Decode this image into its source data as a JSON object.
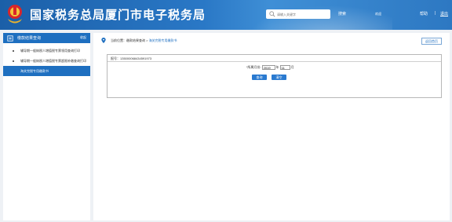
{
  "header": {
    "title": "国家税务总局厦门市电子税务局",
    "search_placeholder": "请输入关键字",
    "search_label": "搜索",
    "welcome": "欢迎",
    "help": "帮助",
    "separator": "|",
    "logout": "退出"
  },
  "sidebar": {
    "title": "缴款结果查询",
    "fold": "收起",
    "items": [
      {
        "label": "辅导期一般纳税人增值税专票领用查询打印"
      },
      {
        "label": "辅导期一般纳税人增值税专票超限补缴查询打印"
      },
      {
        "label": "海关完税专用缴款书"
      }
    ]
  },
  "main": {
    "breadcrumb_prefix": "当前位置：",
    "breadcrumb_parent": "缴款结果查询",
    "breadcrumb_separator": " > ",
    "breadcrumb_current": "海关完税专用缴款书",
    "back_label": "返回首页",
    "doc_number": "报号：135000068434591973",
    "period_label": "*所属月份:",
    "year_value": "2019",
    "year_unit": "年",
    "month_value": "11",
    "month_unit": "月",
    "query_label": "查询",
    "clear_label": "清空"
  },
  "colors": {
    "header_blue": "#1b5fa8",
    "accent": "#1e6fc0",
    "button": "#2a7ad0"
  }
}
